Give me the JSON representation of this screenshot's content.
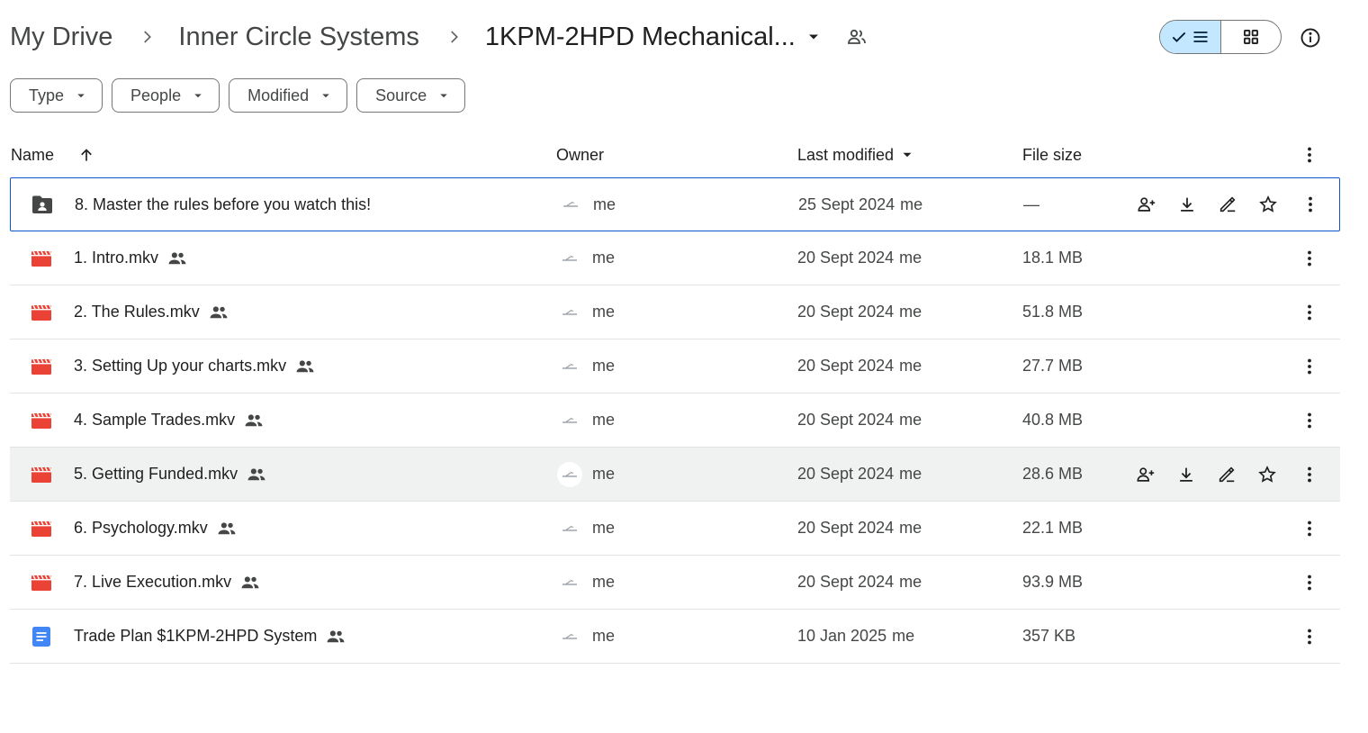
{
  "breadcrumb": {
    "items": [
      "My Drive",
      "Inner Circle Systems"
    ],
    "current": "1KPM-2HPD Mechanical..."
  },
  "filters": [
    "Type",
    "People",
    "Modified",
    "Source"
  ],
  "columns": {
    "name": "Name",
    "owner": "Owner",
    "modified": "Last modified",
    "size": "File size"
  },
  "rows": [
    {
      "name": "8. Master the rules before you watch this!",
      "type": "shared-folder",
      "shared": false,
      "owner": "me",
      "date": "25 Sept 2024",
      "by": "me",
      "size": "—",
      "state": "selected"
    },
    {
      "name": "1. Intro.mkv",
      "type": "video",
      "shared": true,
      "owner": "me",
      "date": "20 Sept 2024",
      "by": "me",
      "size": "18.1 MB",
      "state": ""
    },
    {
      "name": "2. The Rules.mkv",
      "type": "video",
      "shared": true,
      "owner": "me",
      "date": "20 Sept 2024",
      "by": "me",
      "size": "51.8 MB",
      "state": ""
    },
    {
      "name": "3. Setting Up your charts.mkv",
      "type": "video",
      "shared": true,
      "owner": "me",
      "date": "20 Sept 2024",
      "by": "me",
      "size": "27.7 MB",
      "state": ""
    },
    {
      "name": "4. Sample Trades.mkv",
      "type": "video",
      "shared": true,
      "owner": "me",
      "date": "20 Sept 2024",
      "by": "me",
      "size": "40.8 MB",
      "state": ""
    },
    {
      "name": "5. Getting Funded.mkv",
      "type": "video",
      "shared": true,
      "owner": "me",
      "date": "20 Sept 2024",
      "by": "me",
      "size": "28.6 MB",
      "state": "hover"
    },
    {
      "name": "6. Psychology.mkv",
      "type": "video",
      "shared": true,
      "owner": "me",
      "date": "20 Sept 2024",
      "by": "me",
      "size": "22.1 MB",
      "state": ""
    },
    {
      "name": "7. Live Execution.mkv",
      "type": "video",
      "shared": true,
      "owner": "me",
      "date": "20 Sept 2024",
      "by": "me",
      "size": "93.9 MB",
      "state": ""
    },
    {
      "name": "Trade Plan $1KPM-2HPD System",
      "type": "doc",
      "shared": true,
      "owner": "me",
      "date": "10 Jan 2025",
      "by": "me",
      "size": "357 KB",
      "state": ""
    }
  ],
  "row_actions": [
    "share-icon",
    "download-icon",
    "rename-icon",
    "star-icon"
  ],
  "colors": {
    "accent": "#0b57d0",
    "toggle_selected": "#c2e7ff",
    "video_red": "#ea4335",
    "doc_blue": "#4285f4",
    "hover_row": "#f0f2f1"
  }
}
